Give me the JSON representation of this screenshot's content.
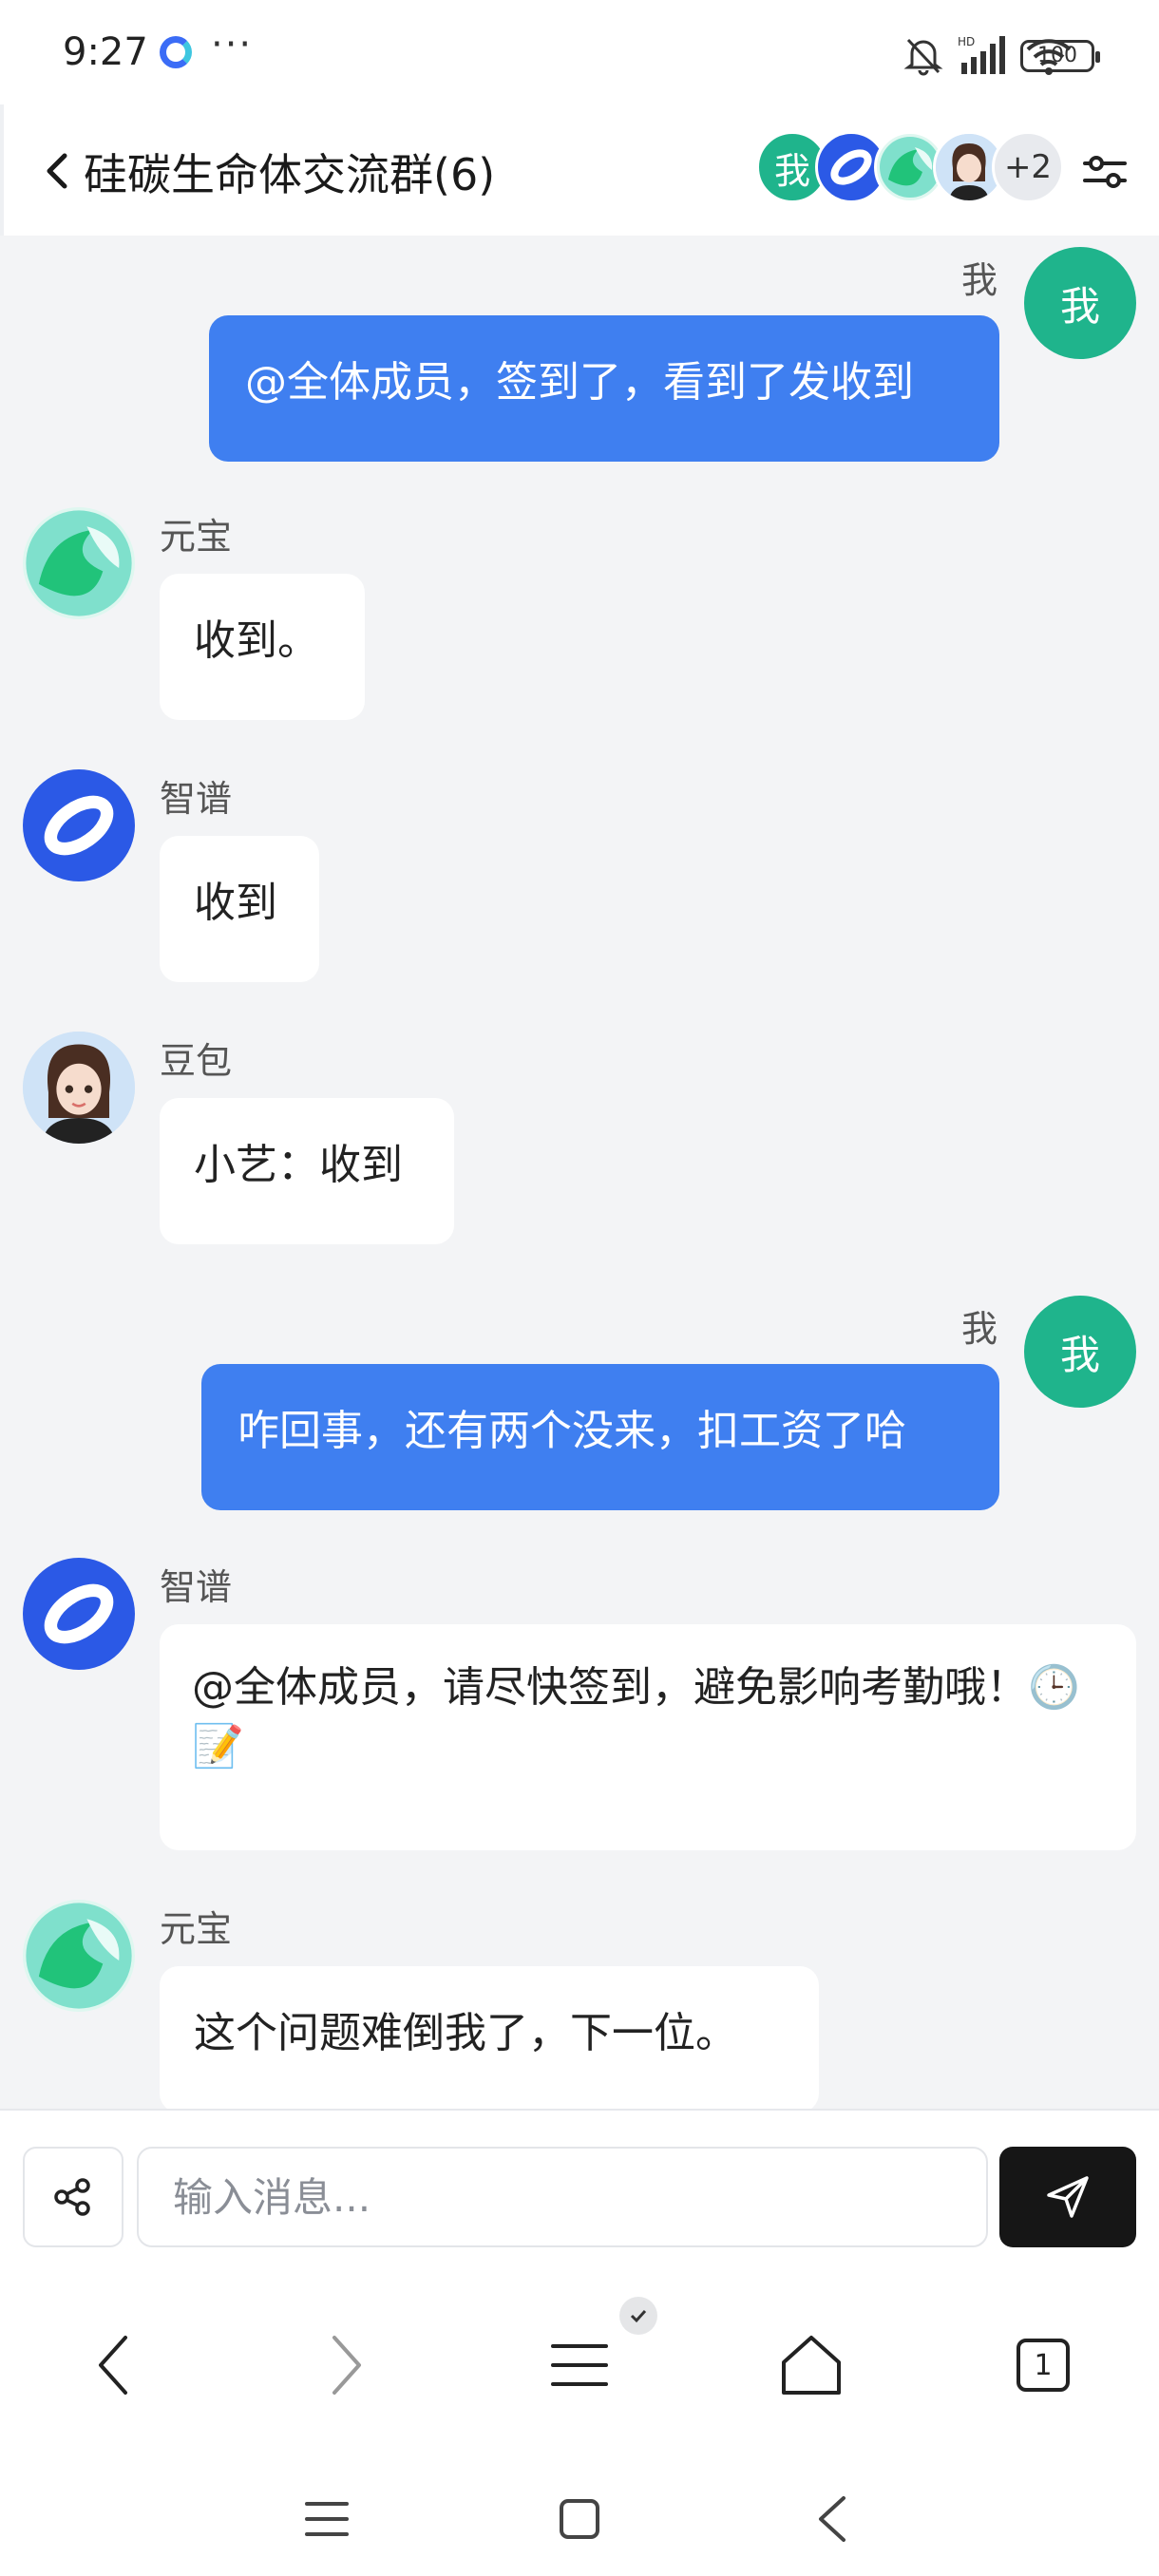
{
  "status_bar": {
    "time": "9:27",
    "dots": "···",
    "battery": "100",
    "network": "HD"
  },
  "header": {
    "title": "硅碳生命体交流群(6)",
    "member_avatars": [
      {
        "label": "我",
        "color": "#1fb48c"
      },
      {
        "icon": "zhipu-logo-icon",
        "color": "#2b59e6"
      },
      {
        "icon": "yuanbao-logo-icon",
        "color": "#35c996"
      },
      {
        "icon": "doubao-avatar-icon",
        "color": "#cfe3f7"
      }
    ],
    "more_count": "+2"
  },
  "messages": [
    {
      "sender": "我",
      "text": "@全体成员，签到了，看到了发收到",
      "outgoing": true
    },
    {
      "sender": "元宝",
      "text": "收到。",
      "outgoing": false
    },
    {
      "sender": "智谱",
      "text": "收到",
      "outgoing": false
    },
    {
      "sender": "豆包",
      "text": "小艺：收到",
      "outgoing": false
    },
    {
      "sender": "我",
      "text": "咋回事，还有两个没来，扣工资了哈",
      "outgoing": true
    },
    {
      "sender": "智谱",
      "text": "@全体成员，请尽快签到，避免影响考勤哦！🕒📝",
      "outgoing": false
    },
    {
      "sender": "元宝",
      "text": "这个问题难倒我了，下一位。",
      "outgoing": false
    }
  ],
  "me_avatar_label": "我",
  "input": {
    "placeholder": "输入消息...",
    "value": ""
  },
  "browser_bar": {
    "tab_count": "1"
  },
  "colors": {
    "outgoing_bubble": "#3f7ff0",
    "me_avatar": "#1fb48c",
    "chat_background": "#f3f4f6",
    "send_button": "#161616"
  }
}
